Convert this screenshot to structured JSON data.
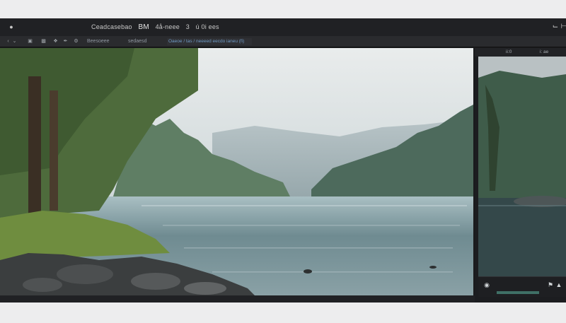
{
  "titlebar": {
    "title_a": "Ceadcasebao",
    "title_b": "BM",
    "title_c": "4å-neee",
    "title_d": "3",
    "title_e": "ú  0i ees"
  },
  "toolbar": {
    "menu_1": "Beesoeee",
    "menu_2": "sedaesd",
    "path": "Oaeoe / tas / neeeed eecdo ianeu (fi)"
  },
  "right_panel": {
    "header_left": "ii:0",
    "header_right": "i:  ae"
  },
  "colors": {
    "window_bg": "#1a1b1d",
    "titlebar_bg": "#202124",
    "toolbar_bg": "#2a2b2e",
    "accent_link": "#6f9ac4"
  },
  "icons": {
    "app": "apple-icon",
    "minimize": "minimize-icon",
    "close": "close-icon"
  }
}
